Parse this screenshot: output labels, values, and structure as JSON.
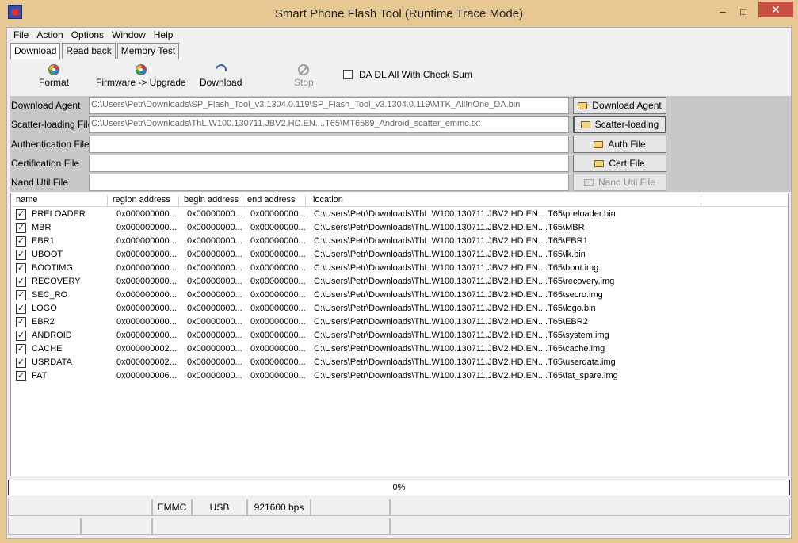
{
  "window": {
    "title": "Smart Phone Flash Tool (Runtime Trace Mode)",
    "minimize": "‒",
    "maximize": "□",
    "close": "✕"
  },
  "menu": [
    "File",
    "Action",
    "Options",
    "Window",
    "Help"
  ],
  "tabs": [
    "Download",
    "Read back",
    "Memory Test"
  ],
  "toolbar": {
    "format": "Format",
    "firmware_upgrade": "Firmware -> Upgrade",
    "download": "Download",
    "stop": "Stop",
    "checksum_label": "DA DL All With Check Sum"
  },
  "files": [
    {
      "label": "Download Agent",
      "value": "C:\\Users\\Petr\\Downloads\\SP_Flash_Tool_v3.1304.0.119\\SP_Flash_Tool_v3.1304.0.119\\MTK_AllInOne_DA.bin",
      "button": "Download Agent"
    },
    {
      "label": "Scatter-loading File",
      "value": "C:\\Users\\Petr\\Downloads\\ThL.W100.130711.JBV2.HD.EN....T65\\MT6589_Android_scatter_emmc.txt",
      "button": "Scatter-loading"
    },
    {
      "label": "Authentication File",
      "value": "",
      "button": "Auth File"
    },
    {
      "label": "Certification File",
      "value": "",
      "button": "Cert File"
    },
    {
      "label": "Nand Util File",
      "value": "",
      "button": "Nand Util File"
    }
  ],
  "columns": [
    "name",
    "region address",
    "begin address",
    "end address",
    "location"
  ],
  "rows": [
    {
      "checked": true,
      "name": "PRELOADER",
      "region": "0x000000000...",
      "begin": "0x00000000...",
      "end": "0x00000000...",
      "location": "C:\\Users\\Petr\\Downloads\\ThL.W100.130711.JBV2.HD.EN....T65\\preloader.bin"
    },
    {
      "checked": true,
      "name": "MBR",
      "region": "0x000000000...",
      "begin": "0x00000000...",
      "end": "0x00000000...",
      "location": "C:\\Users\\Petr\\Downloads\\ThL.W100.130711.JBV2.HD.EN....T65\\MBR"
    },
    {
      "checked": true,
      "name": "EBR1",
      "region": "0x000000000...",
      "begin": "0x00000000...",
      "end": "0x00000000...",
      "location": "C:\\Users\\Petr\\Downloads\\ThL.W100.130711.JBV2.HD.EN....T65\\EBR1"
    },
    {
      "checked": true,
      "name": "UBOOT",
      "region": "0x000000000...",
      "begin": "0x00000000...",
      "end": "0x00000000...",
      "location": "C:\\Users\\Petr\\Downloads\\ThL.W100.130711.JBV2.HD.EN....T65\\lk.bin"
    },
    {
      "checked": true,
      "name": "BOOTIMG",
      "region": "0x000000000...",
      "begin": "0x00000000...",
      "end": "0x00000000...",
      "location": "C:\\Users\\Petr\\Downloads\\ThL.W100.130711.JBV2.HD.EN....T65\\boot.img"
    },
    {
      "checked": true,
      "name": "RECOVERY",
      "region": "0x000000000...",
      "begin": "0x00000000...",
      "end": "0x00000000...",
      "location": "C:\\Users\\Petr\\Downloads\\ThL.W100.130711.JBV2.HD.EN....T65\\recovery.img"
    },
    {
      "checked": true,
      "name": "SEC_RO",
      "region": "0x000000000...",
      "begin": "0x00000000...",
      "end": "0x00000000...",
      "location": "C:\\Users\\Petr\\Downloads\\ThL.W100.130711.JBV2.HD.EN....T65\\secro.img"
    },
    {
      "checked": true,
      "name": "LOGO",
      "region": "0x000000000...",
      "begin": "0x00000000...",
      "end": "0x00000000...",
      "location": "C:\\Users\\Petr\\Downloads\\ThL.W100.130711.JBV2.HD.EN....T65\\logo.bin"
    },
    {
      "checked": true,
      "name": "EBR2",
      "region": "0x000000000...",
      "begin": "0x00000000...",
      "end": "0x00000000...",
      "location": "C:\\Users\\Petr\\Downloads\\ThL.W100.130711.JBV2.HD.EN....T65\\EBR2"
    },
    {
      "checked": true,
      "name": "ANDROID",
      "region": "0x000000000...",
      "begin": "0x00000000...",
      "end": "0x00000000...",
      "location": "C:\\Users\\Petr\\Downloads\\ThL.W100.130711.JBV2.HD.EN....T65\\system.img"
    },
    {
      "checked": true,
      "name": "CACHE",
      "region": "0x000000002...",
      "begin": "0x00000000...",
      "end": "0x00000000...",
      "location": "C:\\Users\\Petr\\Downloads\\ThL.W100.130711.JBV2.HD.EN....T65\\cache.img"
    },
    {
      "checked": true,
      "name": "USRDATA",
      "region": "0x000000002...",
      "begin": "0x00000000...",
      "end": "0x00000000...",
      "location": "C:\\Users\\Petr\\Downloads\\ThL.W100.130711.JBV2.HD.EN....T65\\userdata.img"
    },
    {
      "checked": true,
      "name": "FAT",
      "region": "0x000000006...",
      "begin": "0x00000000...",
      "end": "0x00000000...",
      "location": "C:\\Users\\Petr\\Downloads\\ThL.W100.130711.JBV2.HD.EN....T65\\fat_spare.img"
    }
  ],
  "progress": {
    "label": "0%",
    "value": 0
  },
  "status": {
    "storage": "EMMC",
    "port": "USB",
    "baud": "921600 bps"
  },
  "icons": {
    "format": "gear-icon",
    "firmware": "gear-icon",
    "download": "download-icon",
    "stop": "stop-icon",
    "file_buttons": "folder-icon",
    "check": "check-icon"
  }
}
